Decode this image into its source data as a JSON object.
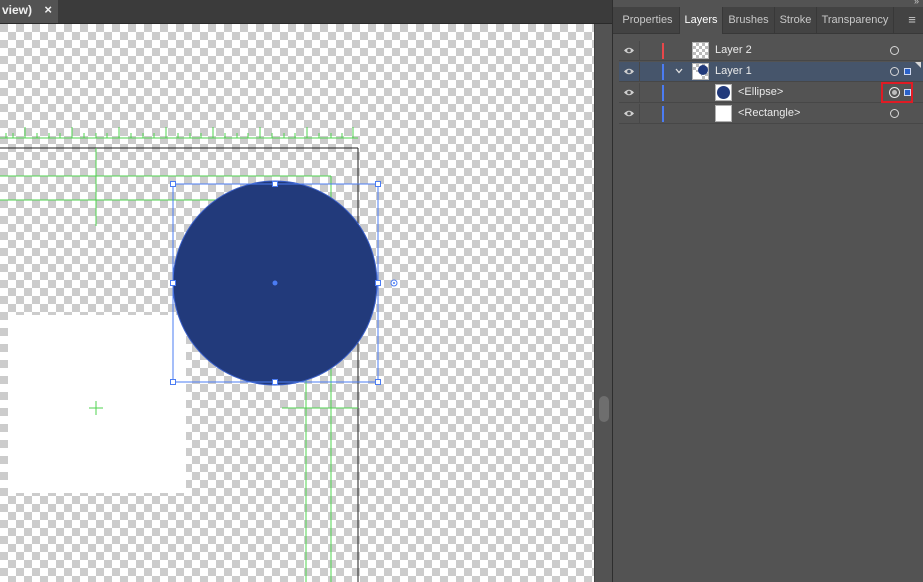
{
  "document": {
    "tab_title": "view)",
    "close_glyph": "×"
  },
  "panel": {
    "tabs": [
      {
        "label": "Properties"
      },
      {
        "label": "Layers",
        "active": true
      },
      {
        "label": "Brushes"
      },
      {
        "label": "Stroke"
      },
      {
        "label": "Transparency"
      }
    ],
    "menu_icon": "panel-menu-icon",
    "layers": [
      {
        "name": "Layer 2",
        "color": "#e8474a",
        "visible": true
      },
      {
        "name": "Layer 1",
        "color": "#4b7cf3",
        "visible": true,
        "expanded": true,
        "selected": true
      },
      {
        "name": "<Ellipse>",
        "color": "#4b7cf3",
        "visible": true,
        "targeted": true,
        "selected_art": true
      },
      {
        "name": "<Rectangle>",
        "color": "#4b7cf3",
        "visible": true
      }
    ]
  },
  "artwork": {
    "ellipse_fill": "#223a7b",
    "rectangle_fill": "#ffffff",
    "guide_color": "#4fd34f",
    "selection_color": "#4b7cf3",
    "highlight_color": "#e01b24"
  }
}
